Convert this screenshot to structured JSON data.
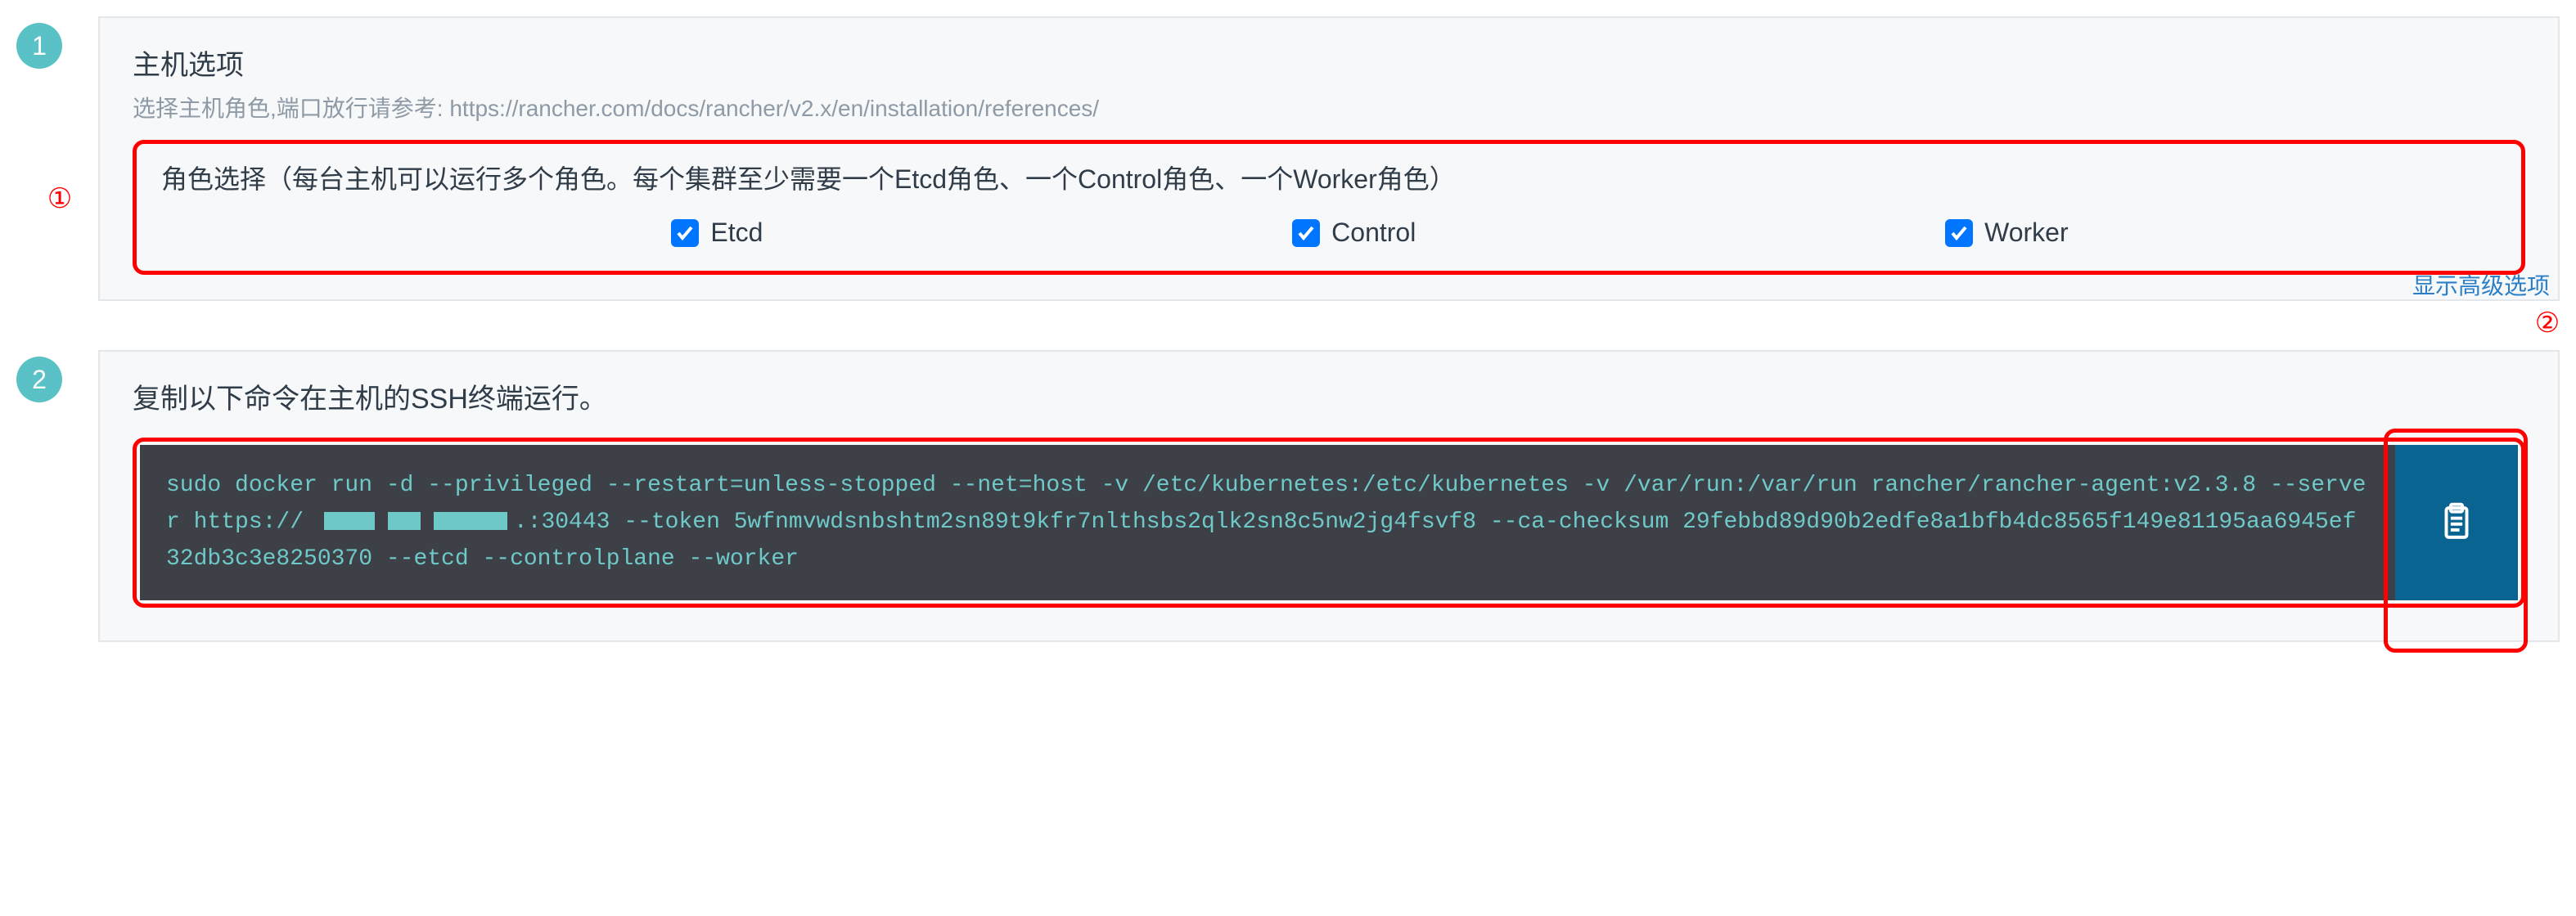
{
  "step1": {
    "number": "1",
    "title": "主机选项",
    "subtitle": "选择主机角色,端口放行请参考: https://rancher.com/docs/rancher/v2.x/en/installation/references/",
    "roleInstruction": "角色选择（每台主机可以运行多个角色。每个集群至少需要一个Etcd角色、一个Control角色、一个Worker角色）",
    "roles": [
      {
        "label": "Etcd",
        "checked": true
      },
      {
        "label": "Control",
        "checked": true
      },
      {
        "label": "Worker",
        "checked": true
      }
    ],
    "advancedLink": "显示高级选项",
    "annotationMark": "①"
  },
  "step2": {
    "number": "2",
    "title": "复制以下命令在主机的SSH终端运行。",
    "annotationMark": "②",
    "command": {
      "pre": "sudo docker run -d --privileged --restart=unless-stopped --net=host -v /etc/kubernetes:/etc/kubernetes -v /var/run:/var/run rancher/rancher-agent:v2.3.8 --server https://",
      "redactedParts": 3,
      "mid": ".:30443 --token 5wfnmvwdsnbshtm2sn89t9kfr7nlthsbs2qlk2sn8c5nw2jg4fsvf8 --ca-checksum 29febbd89d90b2edfe8a1bfb4dc8565f149e81195aa6945ef32db3c3e8250370 --etcd --controlplane --worker"
    }
  }
}
